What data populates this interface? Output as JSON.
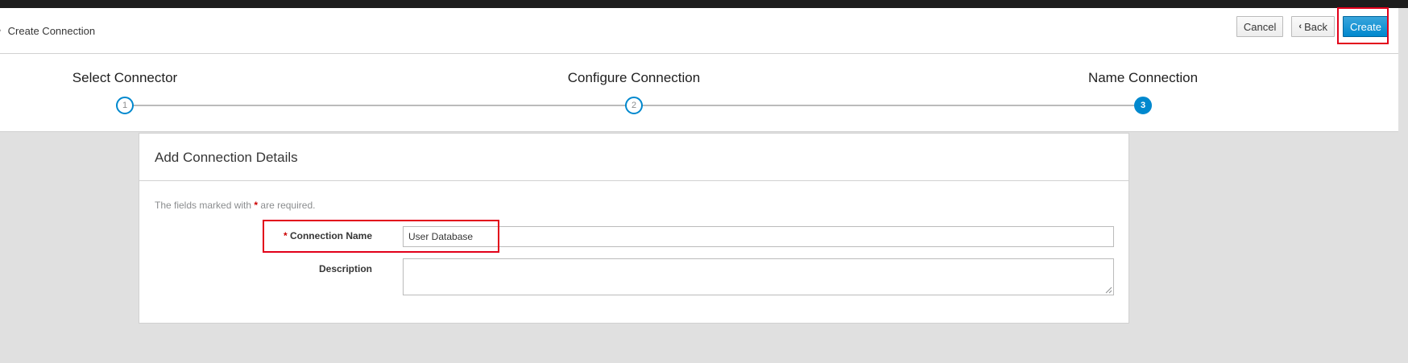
{
  "header": {
    "breadcrumb": "Create Connection",
    "cancel_label": "Cancel",
    "back_label": "Back",
    "create_label": "Create"
  },
  "wizard": {
    "steps": [
      {
        "label": "Select Connector",
        "number": "1",
        "active": false
      },
      {
        "label": "Configure Connection",
        "number": "2",
        "active": false
      },
      {
        "label": "Name Connection",
        "number": "3",
        "active": true
      }
    ]
  },
  "form": {
    "title": "Add Connection Details",
    "required_note_before": "The fields marked with",
    "required_marker": "*",
    "required_note_after": "are required.",
    "name_label": "Connection Name",
    "name_value": "User Database",
    "description_label": "Description",
    "description_value": ""
  },
  "colors": {
    "accent": "#0088ce",
    "highlight": "#e2001a",
    "required": "#cc0000"
  },
  "icons": {
    "breadcrumb_separator": "chevron-right-icon",
    "back": "chevron-left-icon"
  }
}
